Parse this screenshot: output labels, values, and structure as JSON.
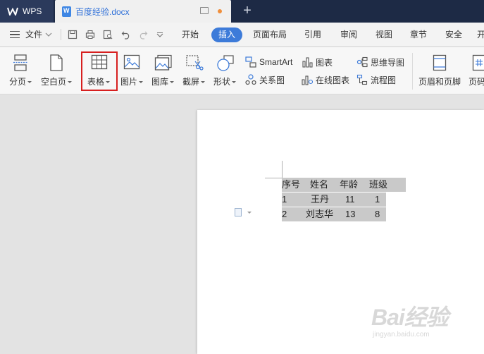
{
  "titlebar": {
    "app_label": "WPS",
    "doc_tab_title": "百度经验.docx",
    "new_tab_symbol": "+"
  },
  "menubar": {
    "file_label": "文件",
    "tabs": [
      "开始",
      "插入",
      "页面布局",
      "引用",
      "审阅",
      "视图",
      "章节",
      "安全",
      "开"
    ],
    "active_tab": "插入"
  },
  "ribbon": {
    "page_break": "分页",
    "blank_page": "空白页",
    "table": "表格",
    "picture": "图片",
    "gallery": "图库",
    "screenshot": "截屏",
    "shapes": "形状",
    "smartart": "SmartArt",
    "chart": "图表",
    "mind_map": "思维导图",
    "relation_chart": "关系图",
    "online_chart": "在线图表",
    "flowchart": "流程图",
    "header_footer": "页眉和页脚",
    "page_number": "页码"
  },
  "colors": {
    "accent": "#3d7bd9",
    "highlight_border": "#d71f1f",
    "titlebar_bg": "#1d2a45",
    "selection": "#c9c9c9"
  },
  "document_table": {
    "headers": [
      "序号",
      "姓名",
      "年龄",
      "班级"
    ],
    "rows": [
      [
        "1",
        "王丹",
        "11",
        "1"
      ],
      [
        "2",
        "刘志华",
        "13",
        "8"
      ]
    ]
  },
  "watermark": {
    "brand": "Bai经验",
    "url": "jingyan.baidu.com"
  }
}
